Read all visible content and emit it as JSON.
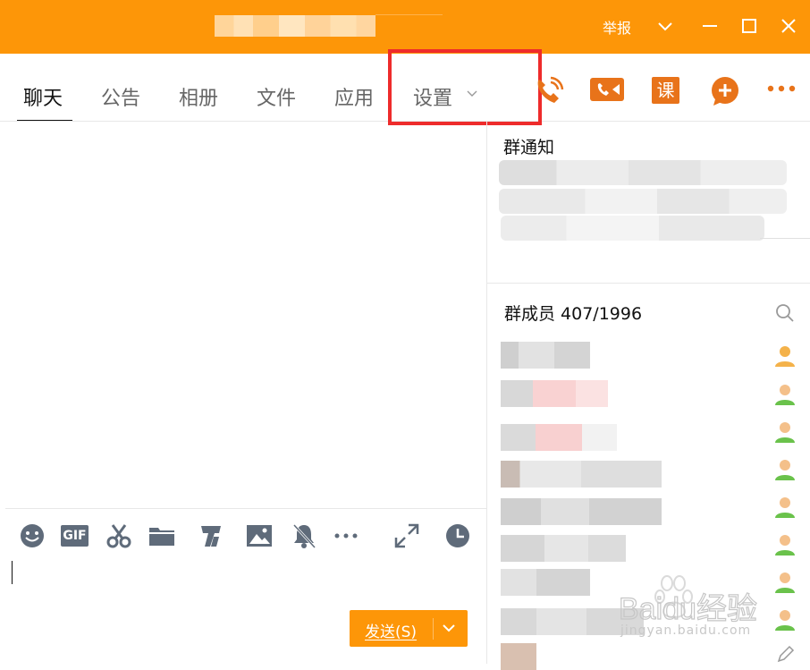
{
  "window": {
    "report_label": "举报",
    "controls": [
      "chevron-down-icon",
      "minimize-icon",
      "maximize-icon",
      "close-icon"
    ]
  },
  "tabs": [
    {
      "label": "聊天",
      "active": true
    },
    {
      "label": "公告"
    },
    {
      "label": "相册"
    },
    {
      "label": "文件"
    },
    {
      "label": "应用"
    },
    {
      "label": "设置"
    }
  ],
  "header_actions": [
    "voice-call-icon",
    "video-call-icon",
    "course-icon",
    "add-app-icon",
    "more-icon"
  ],
  "course_label": "课",
  "notice": {
    "title": "群通知"
  },
  "members": {
    "title": "群成员 407/1996",
    "count": 8
  },
  "toolbar": [
    "emoji-icon",
    "gif-icon",
    "screenshot-icon",
    "folder-icon",
    "font-icon",
    "image-icon",
    "mute-icon",
    "more-icon",
    "expand-icon",
    "history-icon"
  ],
  "gif_label": "GIF",
  "send": {
    "label": "发送(S)"
  },
  "watermark": {
    "brand": "Baidu经验",
    "url": "jingyan.baidu.com"
  },
  "colors": {
    "accent": "#fd9608",
    "highlight": "#ee2b2b",
    "member_icon": "#6ac24b"
  }
}
